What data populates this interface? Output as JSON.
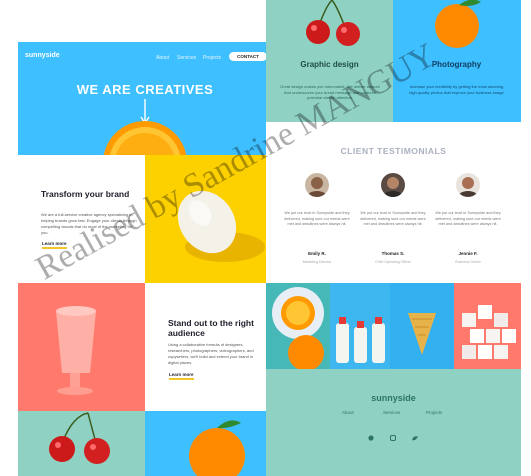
{
  "left_page": {
    "header": {
      "logo": "sunnyside",
      "nav": [
        "About",
        "Services",
        "Projects"
      ],
      "contact": "CONTACT"
    },
    "hero_title": "WE ARE CREATIVES",
    "transform": {
      "title": "Transform your brand",
      "text": "We are a full-service creative agency specializing in helping brands grow fast. Engage your clients through compelling visuals that do most of the marketing for you.",
      "link": "Learn more"
    },
    "standout": {
      "title": "Stand out to the right audience",
      "text": "Using a collaborative formula of designers, researchers, photographers, videographers, and copywriters, we'll build and extend your brand in digital places.",
      "link": "Learn more"
    }
  },
  "right_page": {
    "services": [
      {
        "title": "Graphic design",
        "text": "Great design makes you memorable. We deliver artwork that underscores your brand message and captures potential clients' attention."
      },
      {
        "title": "Photography",
        "text": "Increase your credibility by getting the most stunning, high-quality photos that improve your business image."
      }
    ],
    "testimonials_title": "CLIENT TESTIMONIALS",
    "testimonials": [
      {
        "quote": "We put our trust in Sunnyside and they delivered, making sure our needs were met and deadlines were always hit.",
        "name": "Emily R.",
        "role": "Marketing Director"
      },
      {
        "quote": "We put our trust in Sunnyside and they delivered, making sure our needs were met and deadlines were always hit.",
        "name": "Thomas S.",
        "role": "Chief Operating Officer"
      },
      {
        "quote": "We put our trust in Sunnyside and they delivered, making sure our needs were met and deadlines were always hit.",
        "name": "Jennie F.",
        "role": "Business Owner"
      }
    ],
    "footer": {
      "logo": "sunnyside",
      "nav": [
        "About",
        "Services",
        "Projects"
      ]
    }
  },
  "watermark": "Realised by Sandrine MANGUY",
  "colors": {
    "hero_blue": "#3ebfff",
    "egg_yellow": "#fdd000",
    "cup_coral": "#ff7a6d",
    "mint": "#8fd2c4",
    "footer_text": "#2c7566"
  }
}
